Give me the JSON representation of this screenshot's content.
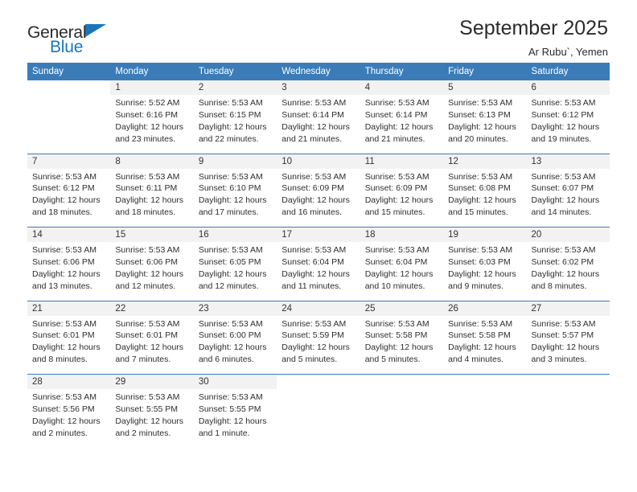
{
  "brand": {
    "name_part1": "General",
    "name_part2": "Blue",
    "accent_color": "#1b75bb"
  },
  "header": {
    "title": "September 2025",
    "subtitle": "Ar Rubu`, Yemen"
  },
  "theme": {
    "header_bg": "#3b7cb8",
    "header_text": "#ffffff",
    "daynum_bg": "#f2f2f2",
    "cell_bg": "#ffffff"
  },
  "weekdays": [
    "Sunday",
    "Monday",
    "Tuesday",
    "Wednesday",
    "Thursday",
    "Friday",
    "Saturday"
  ],
  "weeks": [
    [
      {
        "day": "",
        "sunrise": "",
        "sunset": "",
        "daylight1": "",
        "daylight2": ""
      },
      {
        "day": "1",
        "sunrise": "Sunrise: 5:52 AM",
        "sunset": "Sunset: 6:16 PM",
        "daylight1": "Daylight: 12 hours",
        "daylight2": "and 23 minutes."
      },
      {
        "day": "2",
        "sunrise": "Sunrise: 5:53 AM",
        "sunset": "Sunset: 6:15 PM",
        "daylight1": "Daylight: 12 hours",
        "daylight2": "and 22 minutes."
      },
      {
        "day": "3",
        "sunrise": "Sunrise: 5:53 AM",
        "sunset": "Sunset: 6:14 PM",
        "daylight1": "Daylight: 12 hours",
        "daylight2": "and 21 minutes."
      },
      {
        "day": "4",
        "sunrise": "Sunrise: 5:53 AM",
        "sunset": "Sunset: 6:14 PM",
        "daylight1": "Daylight: 12 hours",
        "daylight2": "and 21 minutes."
      },
      {
        "day": "5",
        "sunrise": "Sunrise: 5:53 AM",
        "sunset": "Sunset: 6:13 PM",
        "daylight1": "Daylight: 12 hours",
        "daylight2": "and 20 minutes."
      },
      {
        "day": "6",
        "sunrise": "Sunrise: 5:53 AM",
        "sunset": "Sunset: 6:12 PM",
        "daylight1": "Daylight: 12 hours",
        "daylight2": "and 19 minutes."
      }
    ],
    [
      {
        "day": "7",
        "sunrise": "Sunrise: 5:53 AM",
        "sunset": "Sunset: 6:12 PM",
        "daylight1": "Daylight: 12 hours",
        "daylight2": "and 18 minutes."
      },
      {
        "day": "8",
        "sunrise": "Sunrise: 5:53 AM",
        "sunset": "Sunset: 6:11 PM",
        "daylight1": "Daylight: 12 hours",
        "daylight2": "and 18 minutes."
      },
      {
        "day": "9",
        "sunrise": "Sunrise: 5:53 AM",
        "sunset": "Sunset: 6:10 PM",
        "daylight1": "Daylight: 12 hours",
        "daylight2": "and 17 minutes."
      },
      {
        "day": "10",
        "sunrise": "Sunrise: 5:53 AM",
        "sunset": "Sunset: 6:09 PM",
        "daylight1": "Daylight: 12 hours",
        "daylight2": "and 16 minutes."
      },
      {
        "day": "11",
        "sunrise": "Sunrise: 5:53 AM",
        "sunset": "Sunset: 6:09 PM",
        "daylight1": "Daylight: 12 hours",
        "daylight2": "and 15 minutes."
      },
      {
        "day": "12",
        "sunrise": "Sunrise: 5:53 AM",
        "sunset": "Sunset: 6:08 PM",
        "daylight1": "Daylight: 12 hours",
        "daylight2": "and 15 minutes."
      },
      {
        "day": "13",
        "sunrise": "Sunrise: 5:53 AM",
        "sunset": "Sunset: 6:07 PM",
        "daylight1": "Daylight: 12 hours",
        "daylight2": "and 14 minutes."
      }
    ],
    [
      {
        "day": "14",
        "sunrise": "Sunrise: 5:53 AM",
        "sunset": "Sunset: 6:06 PM",
        "daylight1": "Daylight: 12 hours",
        "daylight2": "and 13 minutes."
      },
      {
        "day": "15",
        "sunrise": "Sunrise: 5:53 AM",
        "sunset": "Sunset: 6:06 PM",
        "daylight1": "Daylight: 12 hours",
        "daylight2": "and 12 minutes."
      },
      {
        "day": "16",
        "sunrise": "Sunrise: 5:53 AM",
        "sunset": "Sunset: 6:05 PM",
        "daylight1": "Daylight: 12 hours",
        "daylight2": "and 12 minutes."
      },
      {
        "day": "17",
        "sunrise": "Sunrise: 5:53 AM",
        "sunset": "Sunset: 6:04 PM",
        "daylight1": "Daylight: 12 hours",
        "daylight2": "and 11 minutes."
      },
      {
        "day": "18",
        "sunrise": "Sunrise: 5:53 AM",
        "sunset": "Sunset: 6:04 PM",
        "daylight1": "Daylight: 12 hours",
        "daylight2": "and 10 minutes."
      },
      {
        "day": "19",
        "sunrise": "Sunrise: 5:53 AM",
        "sunset": "Sunset: 6:03 PM",
        "daylight1": "Daylight: 12 hours",
        "daylight2": "and 9 minutes."
      },
      {
        "day": "20",
        "sunrise": "Sunrise: 5:53 AM",
        "sunset": "Sunset: 6:02 PM",
        "daylight1": "Daylight: 12 hours",
        "daylight2": "and 8 minutes."
      }
    ],
    [
      {
        "day": "21",
        "sunrise": "Sunrise: 5:53 AM",
        "sunset": "Sunset: 6:01 PM",
        "daylight1": "Daylight: 12 hours",
        "daylight2": "and 8 minutes."
      },
      {
        "day": "22",
        "sunrise": "Sunrise: 5:53 AM",
        "sunset": "Sunset: 6:01 PM",
        "daylight1": "Daylight: 12 hours",
        "daylight2": "and 7 minutes."
      },
      {
        "day": "23",
        "sunrise": "Sunrise: 5:53 AM",
        "sunset": "Sunset: 6:00 PM",
        "daylight1": "Daylight: 12 hours",
        "daylight2": "and 6 minutes."
      },
      {
        "day": "24",
        "sunrise": "Sunrise: 5:53 AM",
        "sunset": "Sunset: 5:59 PM",
        "daylight1": "Daylight: 12 hours",
        "daylight2": "and 5 minutes."
      },
      {
        "day": "25",
        "sunrise": "Sunrise: 5:53 AM",
        "sunset": "Sunset: 5:58 PM",
        "daylight1": "Daylight: 12 hours",
        "daylight2": "and 5 minutes."
      },
      {
        "day": "26",
        "sunrise": "Sunrise: 5:53 AM",
        "sunset": "Sunset: 5:58 PM",
        "daylight1": "Daylight: 12 hours",
        "daylight2": "and 4 minutes."
      },
      {
        "day": "27",
        "sunrise": "Sunrise: 5:53 AM",
        "sunset": "Sunset: 5:57 PM",
        "daylight1": "Daylight: 12 hours",
        "daylight2": "and 3 minutes."
      }
    ],
    [
      {
        "day": "28",
        "sunrise": "Sunrise: 5:53 AM",
        "sunset": "Sunset: 5:56 PM",
        "daylight1": "Daylight: 12 hours",
        "daylight2": "and 2 minutes."
      },
      {
        "day": "29",
        "sunrise": "Sunrise: 5:53 AM",
        "sunset": "Sunset: 5:55 PM",
        "daylight1": "Daylight: 12 hours",
        "daylight2": "and 2 minutes."
      },
      {
        "day": "30",
        "sunrise": "Sunrise: 5:53 AM",
        "sunset": "Sunset: 5:55 PM",
        "daylight1": "Daylight: 12 hours",
        "daylight2": "and 1 minute."
      },
      {
        "day": "",
        "sunrise": "",
        "sunset": "",
        "daylight1": "",
        "daylight2": ""
      },
      {
        "day": "",
        "sunrise": "",
        "sunset": "",
        "daylight1": "",
        "daylight2": ""
      },
      {
        "day": "",
        "sunrise": "",
        "sunset": "",
        "daylight1": "",
        "daylight2": ""
      },
      {
        "day": "",
        "sunrise": "",
        "sunset": "",
        "daylight1": "",
        "daylight2": ""
      }
    ]
  ]
}
